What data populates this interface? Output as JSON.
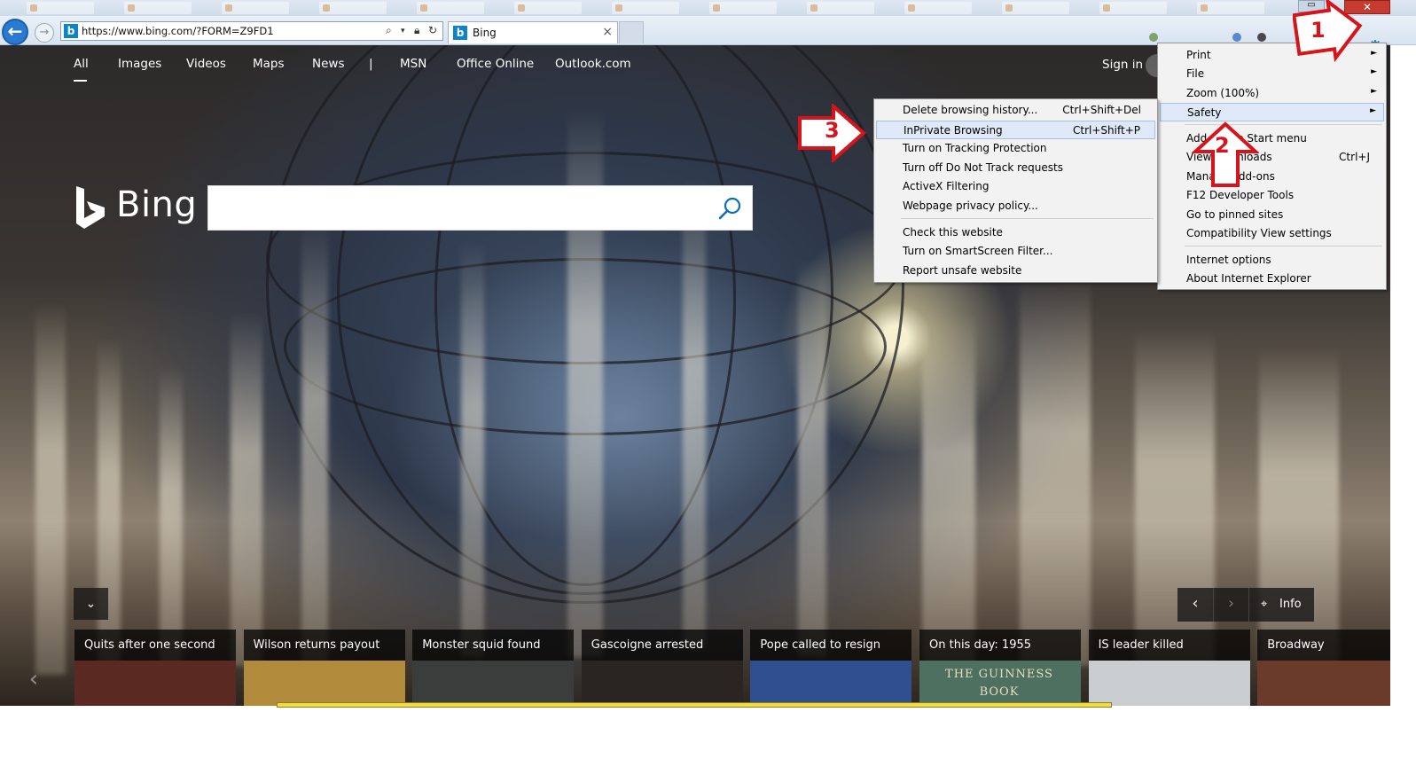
{
  "browser": {
    "address": "https://www.bing.com/?FORM=Z9FD1",
    "tab_title": "Bing",
    "tab_close": "×",
    "back": "←",
    "forward": "→",
    "minimize": "▭",
    "close": "✕",
    "gear": "⚙"
  },
  "bing": {
    "nav": [
      "All",
      "Images",
      "Videos",
      "Maps",
      "News",
      "|",
      "MSN",
      "Office Online",
      "Outlook.com"
    ],
    "sign_in": "Sign in",
    "logo_text": "Bing",
    "info_label": "Info",
    "collapse": "⌄",
    "prev": "‹",
    "next": "›",
    "carousel_left": "‹",
    "carousel_right": "›",
    "news": [
      {
        "title": "Quits after one second",
        "thumb_color": "#5a2a22"
      },
      {
        "title": "Wilson returns payout",
        "thumb_color": "#b28a3c"
      },
      {
        "title": "Monster squid found",
        "thumb_color": "#3a3d3c"
      },
      {
        "title": "Gascoigne arrested",
        "thumb_color": "#2a2422"
      },
      {
        "title": "Pope called to resign",
        "thumb_color": "#2f4f8f"
      },
      {
        "title": "On this day: 1955",
        "thumb_color": "#4d7060"
      },
      {
        "title": "IS leader killed",
        "thumb_color": "#c9cdd0"
      },
      {
        "title": "Broadway",
        "thumb_color": "#6a3a2a"
      }
    ],
    "news_thumb_texts": {
      "guinness": "THE GUINNESS BOOK"
    }
  },
  "tools_menu": {
    "items": [
      {
        "label": "Print",
        "shortcut": "",
        "submenu": true
      },
      {
        "label": "File",
        "shortcut": "",
        "submenu": true
      },
      {
        "label": "Zoom (100%)",
        "shortcut": "",
        "submenu": true
      },
      {
        "label": "Safety",
        "shortcut": "",
        "submenu": true
      },
      {
        "label": "Add site to Start menu",
        "shortcut": "",
        "submenu": false
      },
      {
        "label": "View downloads",
        "shortcut": "Ctrl+J",
        "submenu": false
      },
      {
        "label": "Manage add-ons",
        "shortcut": "",
        "submenu": false
      },
      {
        "label": "F12 Developer Tools",
        "shortcut": "",
        "submenu": false
      },
      {
        "label": "Go to pinned sites",
        "shortcut": "",
        "submenu": false
      },
      {
        "label": "Compatibility View settings",
        "shortcut": "",
        "submenu": false
      },
      {
        "label": "Internet options",
        "shortcut": "",
        "submenu": false
      },
      {
        "label": "About Internet Explorer",
        "shortcut": "",
        "submenu": false
      }
    ],
    "arrow": "►"
  },
  "safety_menu": {
    "items": [
      {
        "label": "Delete browsing history...",
        "shortcut": "Ctrl+Shift+Del"
      },
      {
        "label": "InPrivate Browsing",
        "shortcut": "Ctrl+Shift+P"
      },
      {
        "label": "Turn on Tracking Protection",
        "shortcut": ""
      },
      {
        "label": "Turn off Do Not Track requests",
        "shortcut": ""
      },
      {
        "label": "ActiveX Filtering",
        "shortcut": ""
      },
      {
        "label": "Webpage privacy policy...",
        "shortcut": ""
      },
      {
        "label": "Check this website",
        "shortcut": ""
      },
      {
        "label": "Turn on SmartScreen Filter...",
        "shortcut": ""
      },
      {
        "label": "Report unsafe website",
        "shortcut": ""
      }
    ]
  },
  "callouts": {
    "one": "1",
    "two": "2",
    "three": "3",
    "color": "#d5141b"
  }
}
